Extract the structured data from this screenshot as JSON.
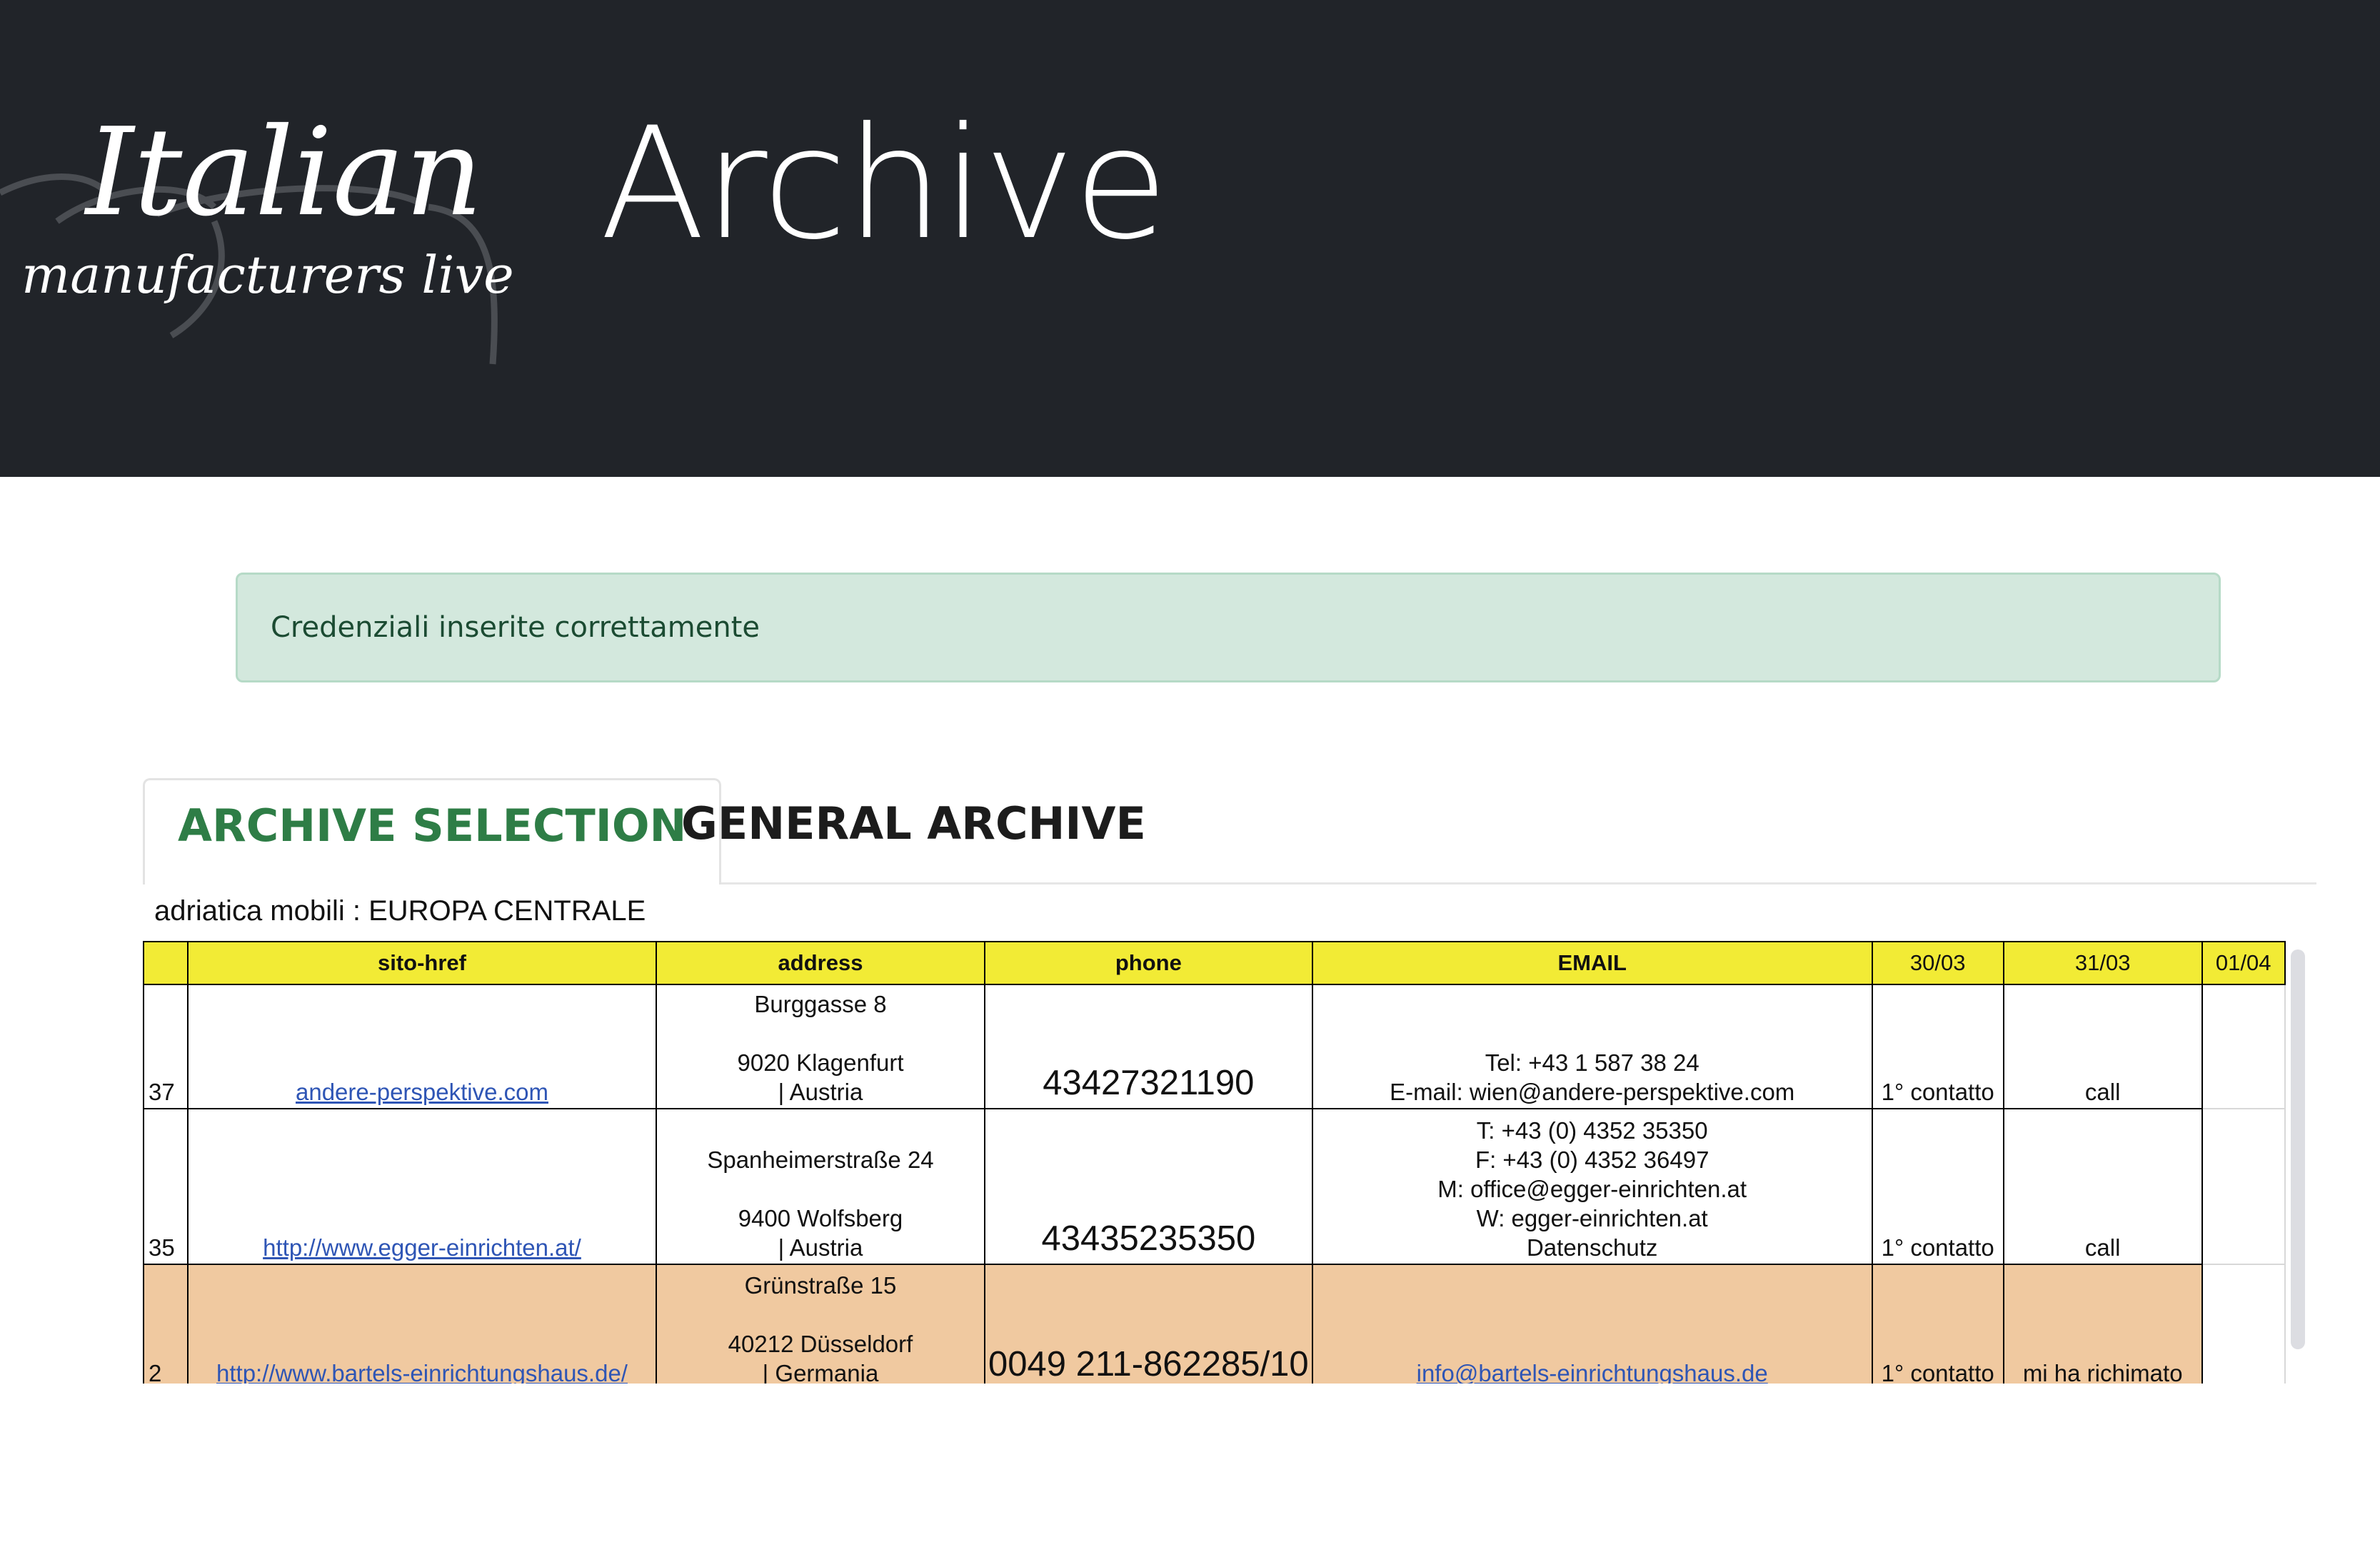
{
  "header": {
    "logo_text_main": "Italian",
    "logo_text_sub": "manufacturers live",
    "title": "Archive"
  },
  "alert": {
    "message": "Credenziali inserite correttamente"
  },
  "tabs": [
    {
      "label": "ARCHIVE SELECTION",
      "active": true
    },
    {
      "label": "GENERAL ARCHIVE",
      "active": false
    }
  ],
  "sheet": {
    "caption": "adriatica mobili : EUROPA CENTRALE",
    "columns": [
      "",
      "sito-href",
      "address",
      "phone",
      "EMAIL",
      "30/03",
      "31/03",
      "01/04"
    ],
    "rows": [
      {
        "index": "37",
        "site": "andere-perspektive.com",
        "address": [
          "Burggasse 8",
          "",
          "9020 Klagenfurt",
          "| Austria"
        ],
        "phone": "43427321190",
        "email": [
          "Tel: +43 1 587 38 24",
          "E-mail: wien@andere-perspektive.com"
        ],
        "d1": "1° contatto",
        "d2": "call",
        "d3": ""
      },
      {
        "index": "35",
        "site": "http://www.egger-einrichten.at/",
        "address": [
          "Spanheimerstraße 24",
          "",
          "9400 Wolfsberg",
          "| Austria"
        ],
        "phone": "43435235350",
        "email": [
          "T: +43 (0) 4352 35350",
          "F: +43 (0) 4352 36497",
          "M: office@egger-einrichten.at",
          "W: egger-einrichten.at",
          "Datenschutz"
        ],
        "d1": "1° contatto",
        "d2": "call",
        "d3": ""
      },
      {
        "index": "2",
        "site": "http://www.bartels-einrichtungshaus.de/",
        "address": [
          "Grünstraße 15",
          "",
          "40212 Düsseldorf",
          "| Germania"
        ],
        "phone": "0049 211-862285/10",
        "email_link": "info@bartels-einrichtungshaus.de",
        "d1": "1° contatto",
        "d2": "mi ha richimato",
        "d3": ""
      }
    ]
  },
  "colors": {
    "header_bg": "#212429",
    "alert_bg": "#d3e8dd",
    "active_tab": "#2e7d46",
    "sheet_header": "#f2eb35",
    "highlight_row": "#f0c9a0",
    "link": "#2e55b5"
  }
}
